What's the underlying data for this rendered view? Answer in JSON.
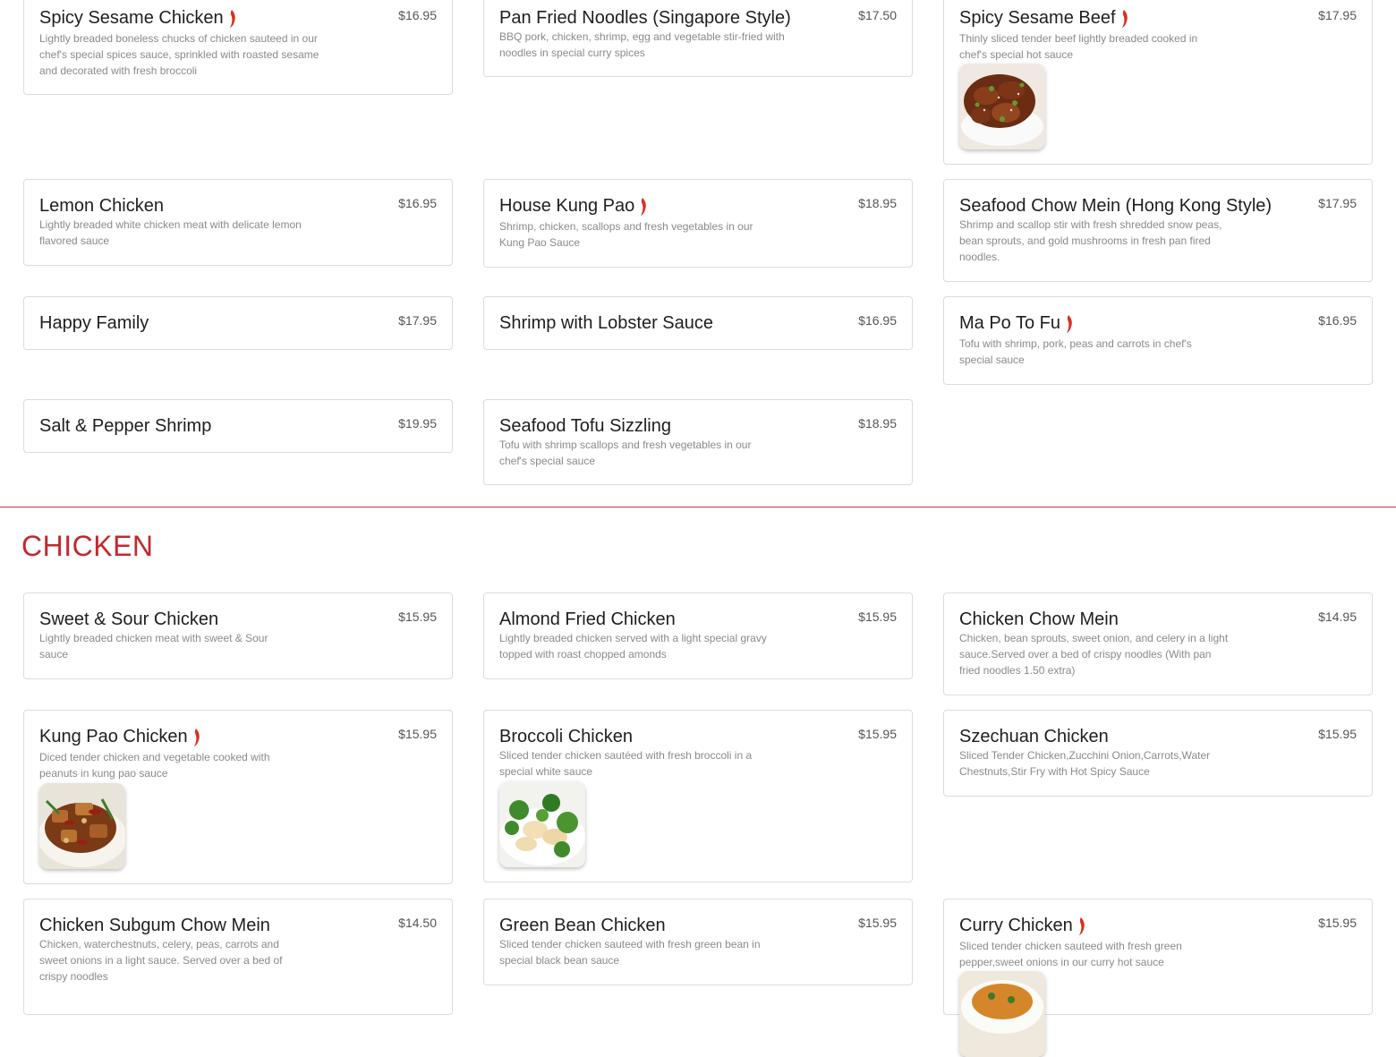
{
  "colors": {
    "accent": "#c3282f",
    "divider": "#c8323e",
    "chili": "#d8311f"
  },
  "items_top": [
    {
      "name": "Spicy Sesame Chicken",
      "spicy": true,
      "price": "$16.95",
      "desc": "Lightly breaded boneless chucks of chicken sauteed in our chef's special spices sauce, sprinkled with roasted sesame and decorated with fresh broccoli"
    },
    {
      "name": "Pan Fried Noodles (Singapore Style)",
      "spicy": false,
      "price": "$17.50",
      "desc": "BBQ pork, chicken, shrimp, egg and vegetable stir-fried with noodles in special curry spices"
    },
    {
      "name": "Spicy Sesame Beef",
      "spicy": true,
      "price": "$17.95",
      "desc": "Thinly sliced tender beef lightly breaded cooked in chef's special hot sauce",
      "image": "sesame-beef-photo"
    },
    {
      "name": "Lemon Chicken",
      "spicy": false,
      "price": "$16.95",
      "desc": "Lightly breaded white chicken meat with delicate lemon flavored sauce"
    },
    {
      "name": "House Kung Pao",
      "spicy": true,
      "price": "$18.95",
      "desc": "Shrimp, chicken, scallops and fresh vegetables in our Kung Pao Sauce"
    },
    {
      "name": "Seafood Chow Mein (Hong Kong Style)",
      "spicy": false,
      "price": "$17.95",
      "desc": "Shrimp and scallop stir with fresh shredded snow peas, bean sprouts, and gold mushrooms in fresh pan fired noodles."
    },
    {
      "name": "Happy Family",
      "spicy": false,
      "price": "$17.95",
      "desc": ""
    },
    {
      "name": "Shrimp with Lobster Sauce",
      "spicy": false,
      "price": "$16.95",
      "desc": ""
    },
    {
      "name": "Ma Po To Fu",
      "spicy": true,
      "price": "$16.95",
      "desc": "Tofu with shrimp, pork, peas and carrots in chef's special sauce"
    },
    {
      "name": "Salt & Pepper Shrimp",
      "spicy": false,
      "price": "$19.95",
      "desc": ""
    },
    {
      "name": "Seafood Tofu Sizzling",
      "spicy": false,
      "price": "$18.95",
      "desc": "Tofu with shrimp scallops and fresh vegetables in our chef's special sauce"
    }
  ],
  "section": {
    "title": "CHICKEN"
  },
  "items_chicken": [
    {
      "name": "Sweet & Sour Chicken",
      "spicy": false,
      "price": "$15.95",
      "desc": "Lightly breaded chicken meat with sweet & Sour sauce"
    },
    {
      "name": "Almond Fried Chicken",
      "spicy": false,
      "price": "$15.95",
      "desc": "Lightly breaded chicken served with a light special gravy topped with roast chopped amonds"
    },
    {
      "name": "Chicken Chow Mein",
      "spicy": false,
      "price": "$14.95",
      "desc": "Chicken, bean sprouts, sweet onion, and celery in a light sauce.Served over a bed of crispy noodles (With pan fried noodles 1.50 extra)"
    },
    {
      "name": "Kung Pao Chicken",
      "spicy": true,
      "price": "$15.95",
      "desc": "Diced tender chicken and vegetable cooked with peanuts in kung pao sauce",
      "image": "kung-pao-chicken-photo"
    },
    {
      "name": "Broccoli Chicken",
      "spicy": false,
      "price": "$15.95",
      "desc": "Sliced tender chicken sautéed with fresh broccoli in a special white sauce",
      "image": "broccoli-chicken-photo"
    },
    {
      "name": "Szechuan Chicken",
      "spicy": false,
      "price": "$15.95",
      "desc": "Sliced Tender Chicken,Zucchini Onion,Carrots,Water Chestnuts,Stir Fry with Hot Spicy Sauce"
    },
    {
      "name": "Chicken Subgum Chow Mein",
      "spicy": false,
      "price": "$14.50",
      "desc": "Chicken, waterchestnuts, celery, peas, carrots and sweet onions in a light sauce. Served over a bed of crispy noodles"
    },
    {
      "name": "Green Bean Chicken",
      "spicy": false,
      "price": "$15.95",
      "desc": "Sliced tender chicken sauteed with fresh green bean in special black bean sauce"
    },
    {
      "name": "Curry Chicken",
      "spicy": true,
      "price": "$15.95",
      "desc": "Sliced tender chicken sauteed with fresh green pepper,sweet onions in our curry hot sauce",
      "image": "curry-chicken-photo"
    }
  ]
}
